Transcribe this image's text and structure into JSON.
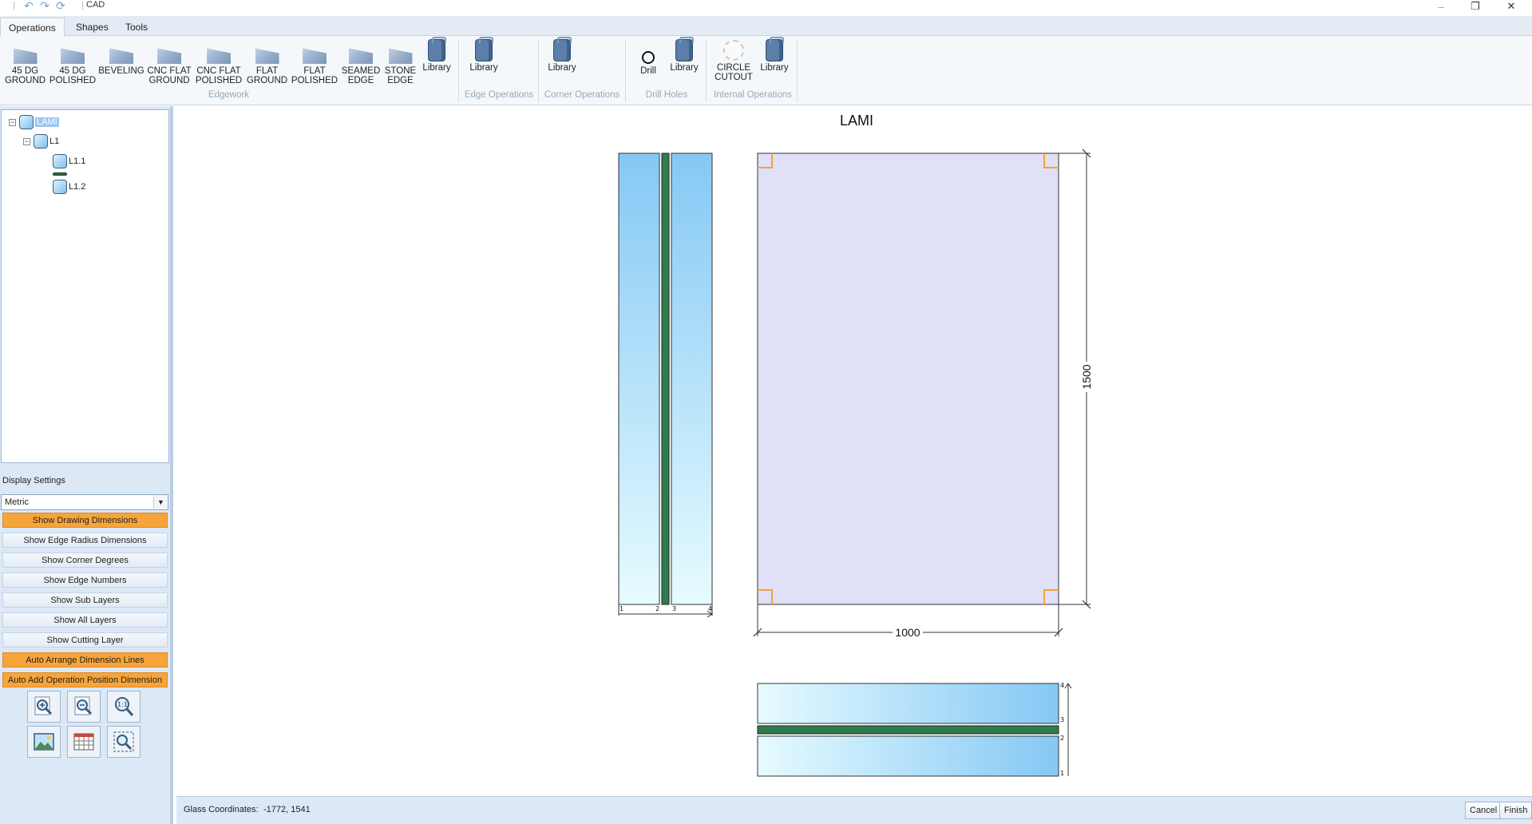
{
  "window": {
    "title": "CAD",
    "quick_access": [
      "undo-icon",
      "redo-icon",
      "refresh-icon"
    ],
    "controls": {
      "minimize": "–",
      "restore": "❐",
      "close": "✕"
    }
  },
  "tabs": [
    {
      "label": "Operations",
      "active": true
    },
    {
      "label": "Shapes",
      "active": false
    },
    {
      "label": "Tools",
      "active": false
    }
  ],
  "ribbon": {
    "edgework": {
      "group_label": "Edgework",
      "buttons": [
        "45 DG\nGROUND",
        "45 DG\nPOLISHED",
        "BEVELING",
        "CNC FLAT\nGROUND",
        "CNC FLAT\nPOLISHED",
        "FLAT\nGROUND",
        "FLAT\nPOLISHED",
        "SEAMED\nEDGE",
        "STONE\nEDGE",
        "Library"
      ]
    },
    "edge_operations": {
      "group_label": "Edge Operations",
      "buttons": [
        "Library"
      ]
    },
    "corner_operations": {
      "group_label": "Corner Operations",
      "buttons": [
        "Library"
      ]
    },
    "drill_holes": {
      "group_label": "Drill Holes",
      "buttons": [
        "Drill",
        "Library"
      ]
    },
    "internal_operations": {
      "group_label": "Internal Operations",
      "buttons": [
        "CIRCLE\nCUTOUT",
        "Library"
      ]
    }
  },
  "tree": {
    "root": "LAMI",
    "child": "L1",
    "leaves": [
      "L1.1",
      "L1.2"
    ]
  },
  "display_settings": {
    "title": "Display Settings",
    "units": "Metric",
    "toggles": [
      {
        "label": "Show Drawing Dimensions",
        "on": true
      },
      {
        "label": "Show Edge Radius Dimensions",
        "on": false
      },
      {
        "label": "Show Corner Degrees",
        "on": false
      },
      {
        "label": "Show Edge Numbers",
        "on": false
      },
      {
        "label": "Show Sub Layers",
        "on": false
      },
      {
        "label": "Show All Layers",
        "on": false
      },
      {
        "label": "Show Cutting Layer",
        "on": false
      },
      {
        "label": "Auto Arrange Dimension Lines",
        "on": true
      },
      {
        "label": "Auto Add Operation Position Dimension",
        "on": true
      }
    ],
    "tools": [
      "zoom-in-icon",
      "zoom-out-icon",
      "zoom-actual-size-icon",
      "export-image-icon",
      "grid-icon",
      "zoom-selection-icon"
    ]
  },
  "drawing": {
    "title": "LAMI",
    "width_dim": "1000",
    "height_dim": "1500",
    "side_layer_numbers": [
      "1",
      "2",
      "3",
      "4"
    ],
    "bottom_layer_numbers": [
      "4",
      "3",
      "2",
      "1"
    ],
    "colors": {
      "face": "#e0e0f8",
      "glass_light": "#e6fbff",
      "glass_dark": "#85c8f4",
      "interlayer": "#2e7d4f",
      "corner": "#f2a23a"
    }
  },
  "status": {
    "coords_label": "Glass Coordinates:",
    "coords_value": "-1772, 1541",
    "cancel": "Cancel",
    "finish": "Finish"
  }
}
